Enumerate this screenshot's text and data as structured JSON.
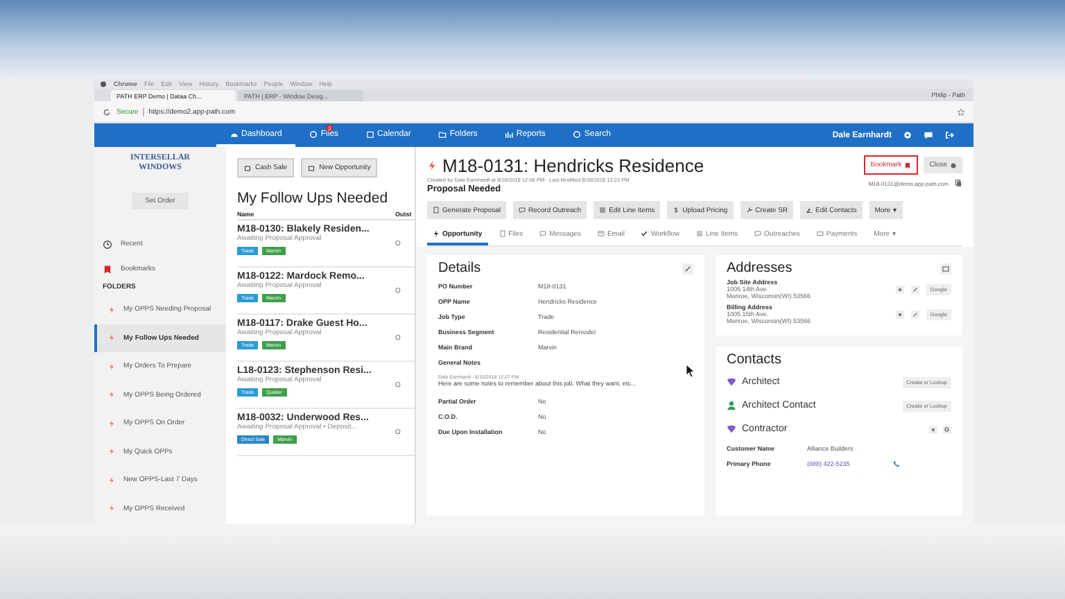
{
  "os_menu": [
    "Chrome",
    "File",
    "Edit",
    "View",
    "History",
    "Bookmarks",
    "People",
    "Window",
    "Help"
  ],
  "browser": {
    "tabs": [
      {
        "label": "PATH ERP Demo | Dataa Ch...",
        "selected": true
      },
      {
        "label": "PATH | ERP - Window Desig...",
        "selected": false
      }
    ],
    "profile": "Philip - Path",
    "security": "Secure",
    "url": "https://demo2.app-path.com"
  },
  "nav": {
    "items": [
      {
        "label": "Dashboard",
        "selected": true
      },
      {
        "label": "Files",
        "badge": "3",
        "selected": false
      },
      {
        "label": "Calendar",
        "selected": false
      },
      {
        "label": "Folders",
        "selected": false
      },
      {
        "label": "Reports",
        "selected": false
      },
      {
        "label": "Search",
        "selected": false
      }
    ],
    "user": "Dale Earnhardt"
  },
  "sidebar": {
    "logo": [
      "INTERSELLAR",
      "WINDOWS"
    ],
    "set_order": "Set Order",
    "items": [
      {
        "label": "Recent",
        "kind": "recent"
      },
      {
        "label": "Bookmarks",
        "kind": "bookmark"
      }
    ],
    "folders_heading": "FOLDERS",
    "folders": [
      {
        "label": "My OPPS Needing Proposal",
        "selected": false
      },
      {
        "label": "My Follow Ups Needed",
        "selected": true
      },
      {
        "label": "My Orders To Prepare",
        "selected": false
      },
      {
        "label": "My OPPS Being Ordered",
        "selected": false
      },
      {
        "label": "My OPPS On Order",
        "selected": false
      },
      {
        "label": "My Quick OPPs",
        "selected": false
      },
      {
        "label": "New OPPS-Last 7 Days",
        "selected": false
      },
      {
        "label": "My OPPS Received",
        "selected": false
      }
    ]
  },
  "list": {
    "buttons": [
      "Cash Sale",
      "New Opportunity"
    ],
    "title": "My Follow Ups Needed",
    "columns": [
      "Name",
      "Outst"
    ],
    "rows": [
      {
        "title": "M18-0130: Blakely Residen...",
        "status": "Awaiting Proposal Approval",
        "column_2": "O",
        "tags": [
          {
            "label": "Trade",
            "color": "#2b9bd8"
          },
          {
            "label": "Marvin",
            "color": "#3f9f4a"
          }
        ]
      },
      {
        "title": "M18-0122: Mardock Remo...",
        "status": "Awaiting Proposal Approval",
        "column_2": "O",
        "tags": [
          {
            "label": "Trade",
            "color": "#2b9bd8"
          },
          {
            "label": "Marvin",
            "color": "#3f9f4a"
          }
        ]
      },
      {
        "title": "M18-0117: Drake Guest Ho...",
        "status": "Awaiting Proposal Approval",
        "column_2": "O",
        "tags": [
          {
            "label": "Trade",
            "color": "#2b9bd8"
          },
          {
            "label": "Marvin",
            "color": "#3f9f4a"
          }
        ]
      },
      {
        "title": "L18-0123: Stephenson Resi...",
        "status": "Awaiting Proposal Approval",
        "column_2": "O",
        "tags": [
          {
            "label": "Trade",
            "color": "#2b9bd8"
          },
          {
            "label": "Quaker",
            "color": "#3f9f4a"
          }
        ]
      },
      {
        "title": "M18-0032: Underwood Res...",
        "status": "Awaiting Proposal Approval • Deposit...",
        "column_2": "O",
        "tags": [
          {
            "label": "Direct Sale",
            "color": "#2b86c8"
          },
          {
            "label": "Marvin",
            "color": "#3f9f4a"
          }
        ]
      }
    ]
  },
  "detail": {
    "title": "M18-0131: Hendricks Residence",
    "meta": "Created by Dale Earnhardt at 8/16/2018 12:06 PM · Last Modified 8/16/2018 12:21 PM",
    "status": "Proposal Needed",
    "bookmark": "Bookmark",
    "close": "Close",
    "email": "M18-0131@demo.app-path.com",
    "actions": [
      {
        "label": "Generate Proposal"
      },
      {
        "label": "Record Outreach"
      },
      {
        "label": "Edit Line Items"
      },
      {
        "label": "Upload Pricing"
      },
      {
        "label": "Create SR"
      },
      {
        "label": "Edit Contacts"
      },
      {
        "label": "More",
        "caret": "▾"
      }
    ],
    "tabs": [
      {
        "label": "Opportunity",
        "selected": true
      },
      {
        "label": "Files",
        "selected": false
      },
      {
        "label": "Messages",
        "selected": false
      },
      {
        "label": "Email",
        "selected": false
      },
      {
        "label": "Workflow",
        "selected": false
      },
      {
        "label": "Line Items",
        "selected": false
      },
      {
        "label": "Outreaches",
        "selected": false
      },
      {
        "label": "Payments",
        "selected": false
      },
      {
        "label": "More",
        "caret": "▾",
        "selected": false
      }
    ],
    "details": {
      "title": "Details",
      "rows": [
        {
          "label": "PO Number",
          "value": "M18-0131"
        },
        {
          "label": "OPP Name",
          "value": "Hendricks Residence"
        },
        {
          "label": "Job Type",
          "value": "Trade"
        },
        {
          "label": "Business Segment",
          "value": "Residential Remodel"
        },
        {
          "label": "Main Brand",
          "value": "Marvin"
        },
        {
          "label": "General Notes"
        }
      ],
      "note": {
        "meta": "Dale Earnhardt - 8/16/2018 12:07 PM",
        "text": "Here are some notes to remember about this job. What they want, etc..."
      },
      "rows_after": [
        {
          "label": "Partial Order",
          "value": "No"
        },
        {
          "label": "C.O.D.",
          "value": "No"
        },
        {
          "label": "Due Upon Installation",
          "value": "No"
        }
      ]
    },
    "addresses": {
      "title": "Addresses",
      "items": [
        {
          "label": "Job Site Address",
          "line1": "1005 14th Ave.",
          "line2": "Monroe, Wisconsin(WI) 53566",
          "map": "Google"
        },
        {
          "label": "Billing Address",
          "line1": "1005 15th Ave.",
          "line2": "Monroe, Wisconsin(WI) 53566",
          "map": "Google"
        }
      ]
    },
    "contacts": {
      "title": "Contacts",
      "roles": [
        {
          "label": "Architect",
          "kind": "company",
          "action": "Create or Lookup"
        },
        {
          "label": "Architect Contact",
          "kind": "person",
          "action": "Create or Lookup"
        },
        {
          "label": "Contractor",
          "kind": "company"
        }
      ],
      "fields": [
        {
          "label": "Customer Name",
          "value": "Alliance Builders",
          "kind": "text"
        },
        {
          "label": "Primary Phone",
          "value": "(888) 422-5235",
          "kind": "phone"
        }
      ]
    }
  }
}
